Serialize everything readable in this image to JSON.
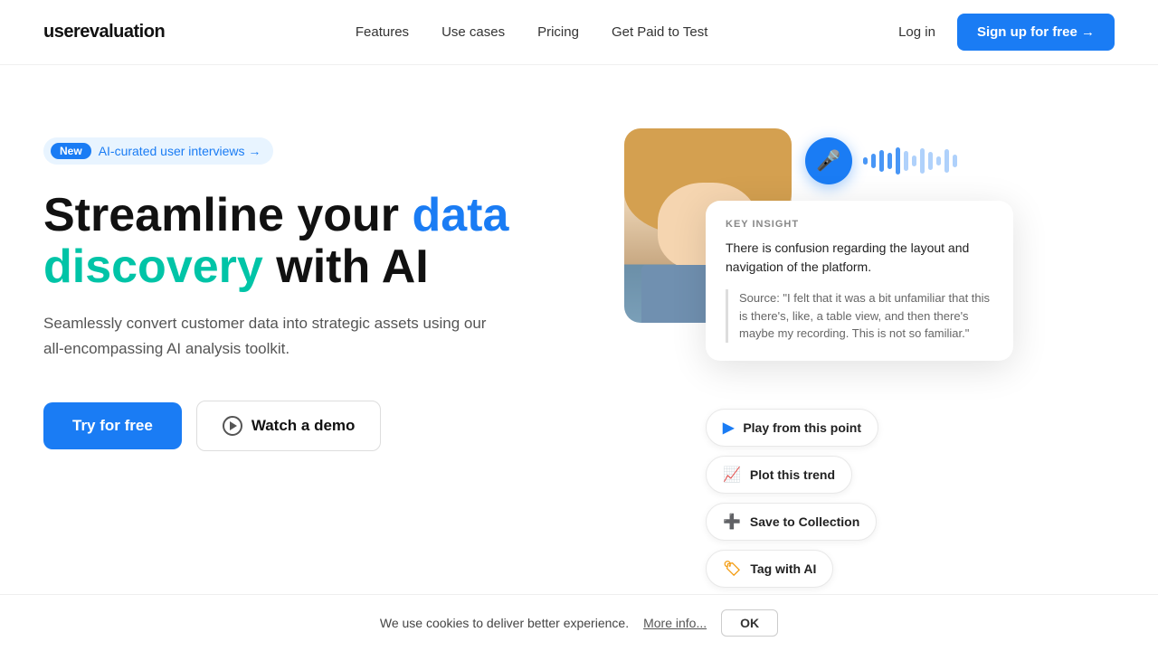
{
  "nav": {
    "logo": "userevaluation",
    "links": [
      {
        "label": "Features",
        "id": "features"
      },
      {
        "label": "Use cases",
        "id": "use-cases"
      },
      {
        "label": "Pricing",
        "id": "pricing"
      },
      {
        "label": "Get Paid to Test",
        "id": "get-paid"
      }
    ],
    "login_label": "Log in",
    "signup_label": "Sign up for free →"
  },
  "hero": {
    "badge_new": "New",
    "badge_text": "AI-curated user interviews →",
    "headline_part1": "Streamline your ",
    "headline_accent1": "data",
    "headline_part2": " ",
    "headline_accent2": "discovery",
    "headline_part3": " with AI",
    "subtext": "Seamlessly convert customer data into strategic assets using our all-encompassing AI analysis toolkit.",
    "btn_primary": "Try for free",
    "btn_demo": "Watch a demo"
  },
  "insight_card": {
    "label": "KEY INSIGHT",
    "text": "There is confusion regarding the layout and navigation of the platform.",
    "source": "Source: \"I felt that it was a bit unfamiliar that this is there's, like, a table view, and then there's maybe my recording. This is not so familiar.\""
  },
  "actions": [
    {
      "label": "Play from this point",
      "icon": "▶",
      "color": "#1a7cf4"
    },
    {
      "label": "Plot this trend",
      "icon": "📈",
      "color": "#9b59b6"
    },
    {
      "label": "Save to Collection",
      "icon": "➕",
      "color": "#e74c3c"
    },
    {
      "label": "Tag with AI",
      "icon": "🏷",
      "color": "#f39c12"
    }
  ],
  "waveform": {
    "bars": [
      8,
      16,
      24,
      18,
      30,
      22,
      12,
      28,
      20,
      10,
      26,
      14
    ]
  },
  "cookie": {
    "text": "We use cookies to deliver better experience.",
    "more_label": "More info...",
    "ok_label": "OK"
  }
}
